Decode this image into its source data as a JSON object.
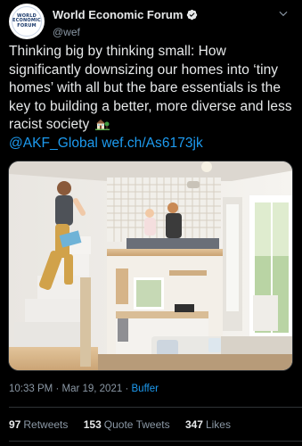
{
  "author": {
    "avatar_text": [
      "WORLD",
      "ECONOMIC",
      "FORUM"
    ],
    "display_name": "World Economic Forum",
    "handle": "@wef",
    "verified": true
  },
  "tweet": {
    "text": "Thinking big by thinking small: How significantly downsizing our homes into ‘tiny homes’ with all but the bare essentials is the key to building a better, more diverse and less racist society",
    "emoji_icon": "house-with-garden-icon",
    "links": {
      "mention": "@AKF_Global",
      "url": "wef.ch/As6173jk"
    }
  },
  "meta": {
    "time": "10:33 PM",
    "separator": "·",
    "date": "Mar 19, 2021",
    "source": "Buffer"
  },
  "stats": {
    "retweets_count": "97",
    "retweets_label": "Retweets",
    "quotes_count": "153",
    "quotes_label": "Quote Tweets",
    "likes_count": "347",
    "likes_label": "Likes"
  },
  "colors": {
    "background": "#000000",
    "text": "#e7e9ea",
    "secondary": "#8b98a5",
    "link": "#1d9bf0",
    "divider": "#2f3336"
  }
}
